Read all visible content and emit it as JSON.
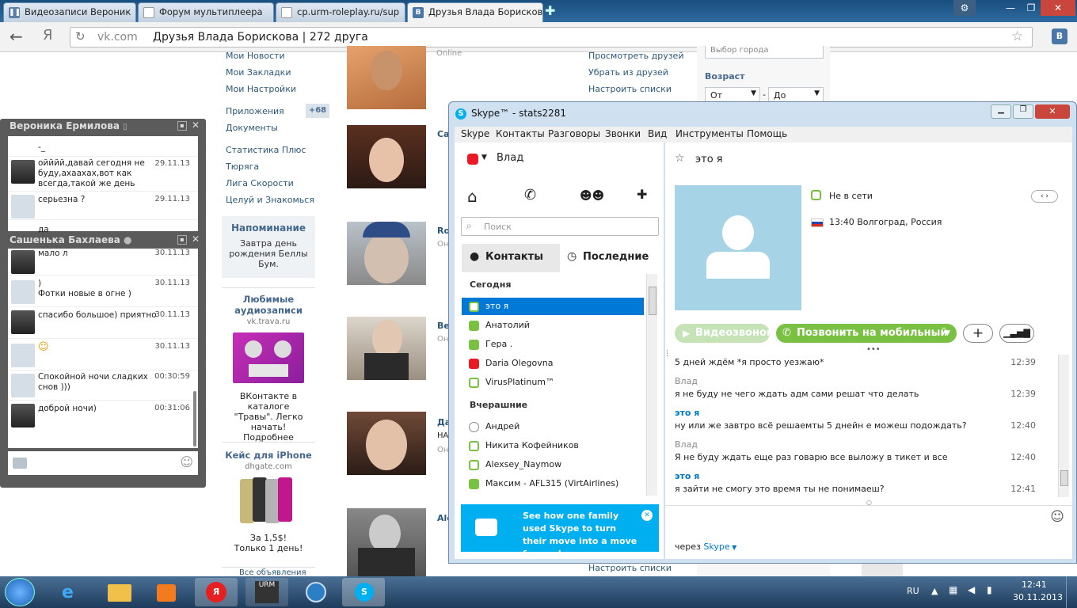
{
  "browser": {
    "tabs": [
      {
        "label": "Видеозаписи Вероник",
        "icon": "pause-icon"
      },
      {
        "label": "Форум мультиплеера",
        "icon": "document-icon"
      },
      {
        "label": "cp.urm-roleplay.ru/sup",
        "icon": "document-icon"
      },
      {
        "label": "Друзья Влада Борискова",
        "icon": "vk-icon"
      }
    ],
    "url_domain": "vk.com",
    "url_title": "Друзья Влада Борискова | 272 друга",
    "yandex_logo": "Я",
    "vk_badge": "B",
    "win_buttons": [
      "⚙",
      "—",
      "❐",
      "✕"
    ]
  },
  "vk": {
    "left_menu": [
      "Мои Новости",
      "Мои Закладки",
      "Мои Настройки"
    ],
    "apps": {
      "label": "Приложения",
      "badge": "+68"
    },
    "docs": "Документы",
    "app_links": [
      "Статистика Плюс",
      "Тюряга",
      "Лига Скорости",
      "Целуй и Знакомься"
    ],
    "reminder": {
      "title": "Напоминание",
      "text": "Завтра день рождения Беллы Бум."
    },
    "ad1": {
      "title": "Любимые аудиозаписи",
      "domain": "vk.trava.ru",
      "text": "ВКонтакте в каталоге \"Травы\". Легко начать! Подробнее"
    },
    "ad2": {
      "title": "Кейс для iPhone",
      "domain": "dhgate.com",
      "text": "За 1,5$! Только 1 день!"
    },
    "ad_more": "Все объявления",
    "friends_names": [
      "Online",
      "Са",
      "Ro",
      "Онл",
      "Ве",
      "Онл",
      "Да",
      "НА",
      "Онл",
      "Ale"
    ],
    "right_links": [
      "Просмотреть друзей",
      "Убрать из друзей",
      "Настроить списки"
    ],
    "right_link_bottom": "Настроить списки",
    "filter": {
      "city": "Выбор города",
      "age_label": "Возраст",
      "from": "От",
      "dash": "-",
      "to": "До"
    }
  },
  "chat1": {
    "title": "Вероника Ермилова",
    "messages": [
      {
        "text": "-_",
        "time": ""
      },
      {
        "text": "ойййй,давай сегодня не буду,ахаахах,вот как всегда,такой же день",
        "time": "29.11.13"
      },
      {
        "text": "серьезна ?",
        "time": "29.11.13"
      },
      {
        "text": "да",
        "time": ""
      }
    ]
  },
  "chat2": {
    "title": "Сашенька Бахлаева",
    "messages": [
      {
        "text": "мало л",
        "time": "30.11.13"
      },
      {
        "text": ")\nФотки новые в огне )",
        "time": "30.11.13"
      },
      {
        "text": "спасибо большое) приятно",
        "time": "30.11.13"
      },
      {
        "text": "☺",
        "time": "30.11.13"
      },
      {
        "text": "Спокойной ночи сладких снов )))",
        "time": "00:30:59"
      },
      {
        "text": "доброй ночи)",
        "time": "00:31:06"
      }
    ]
  },
  "skype": {
    "title": "Skype™ - stats2281",
    "menu": [
      "Skype",
      "Контакты",
      "Разговоры",
      "Звонки",
      "Вид",
      "Инструменты",
      "Помощь"
    ],
    "user": "Влад",
    "search_placeholder": "Поиск",
    "tabs": [
      "Контакты",
      "Последние"
    ],
    "groups": [
      {
        "name": "Сегодня",
        "contacts": [
          {
            "name": "это я",
            "status": "off",
            "selected": true
          },
          {
            "name": "Анатолий",
            "status": "on"
          },
          {
            "name": "Гера .",
            "status": "on"
          },
          {
            "name": "Daria Olegovna",
            "status": "dnd"
          },
          {
            "name": "VirusPlatinum™",
            "status": "off"
          }
        ]
      },
      {
        "name": "Вчерашние",
        "contacts": [
          {
            "name": "Андрей",
            "status": "unk"
          },
          {
            "name": "Никита Кофейников",
            "status": "off"
          },
          {
            "name": "Alexsey_Naymow",
            "status": "off"
          },
          {
            "name": "Максим - AFL315 (VirtAirlines)",
            "status": "on"
          }
        ]
      }
    ],
    "promo": "See how one family used Skype to turn their move into a move forward.",
    "conv_title": "это я",
    "presence": "Не в сети",
    "local_time": "13:40 Волгоград, Россия",
    "btn_video": "Видеозвонок",
    "btn_call": "Позвонить на мобильный",
    "messages": [
      {
        "author": "",
        "text": "5 дней ждём *я просто уезжаю*",
        "time": "12:39"
      },
      {
        "author": "Влад",
        "text": "я не буду не чего ждать адм сами решат что делать",
        "time": "12:39"
      },
      {
        "author": "это я",
        "text": "ну или же завтро всё решаемты 5 днейн е можеш подождать?",
        "time": "12:40"
      },
      {
        "author": "Влад",
        "text": "Я не буду ждать еще раз говарю все выложу в тикет и все",
        "time": "12:40"
      },
      {
        "author": "это я",
        "text": "я зайти не смогу это время ты не понимаеш?",
        "time": "12:41"
      }
    ],
    "via": "через",
    "via_link": "Skype"
  },
  "taskbar": {
    "lang": "RU",
    "time": "12:41",
    "date": "30.11.2013",
    "urm": "URM"
  }
}
